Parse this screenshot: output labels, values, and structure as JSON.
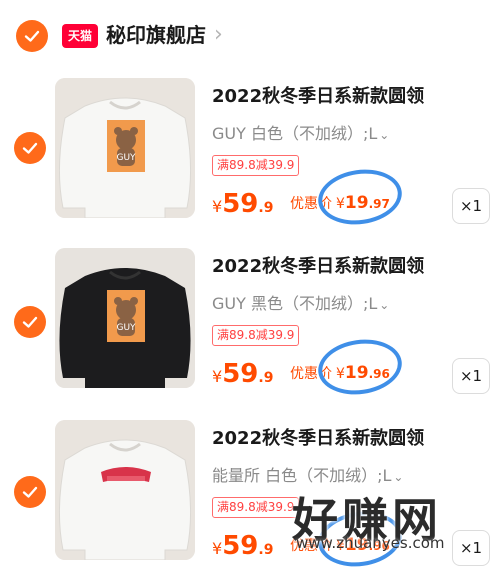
{
  "store": {
    "logo_text": "天猫",
    "name": "秘印旗舰店",
    "chevron": "›"
  },
  "colors": {
    "accent": "#ff6a1a",
    "price": "#ff4a00",
    "promo_border": "#ff6b6b",
    "annotation": "#3f8fe8",
    "tmall_red": "#ff0036"
  },
  "items": [
    {
      "title": "2022秋冬季日系新款圆领",
      "variant": "GUY 白色（不加绒）;L",
      "promo": "满89.8减39.9",
      "price_currency": "¥",
      "price_int": "59",
      "price_dec": ".9",
      "coupon_label": "优惠价",
      "coupon_currency": "¥",
      "coupon_int": "19",
      "coupon_dec": ".97",
      "qty": "×1",
      "shirt_color": "white",
      "print_text": "GUY"
    },
    {
      "title": "2022秋冬季日系新款圆领",
      "variant": "GUY 黑色（不加绒）;L",
      "promo": "满89.8减39.9",
      "price_currency": "¥",
      "price_int": "59",
      "price_dec": ".9",
      "coupon_label": "优惠价",
      "coupon_currency": "¥",
      "coupon_int": "19",
      "coupon_dec": ".96",
      "qty": "×1",
      "shirt_color": "black",
      "print_text": "GUY"
    },
    {
      "title": "2022秋冬季日系新款圆领",
      "variant": "能量所 白色（不加绒）;L",
      "promo": "满89.8减39.9",
      "price_currency": "¥",
      "price_int": "59",
      "price_dec": ".9",
      "coupon_label": "优惠价",
      "coupon_currency": "¥",
      "coupon_int": "19",
      "coupon_dec": ".96",
      "qty": "×1",
      "shirt_color": "white",
      "print_text": ""
    }
  ],
  "watermark": {
    "text": "好赚网",
    "url": "www.zhuanyes.com"
  }
}
